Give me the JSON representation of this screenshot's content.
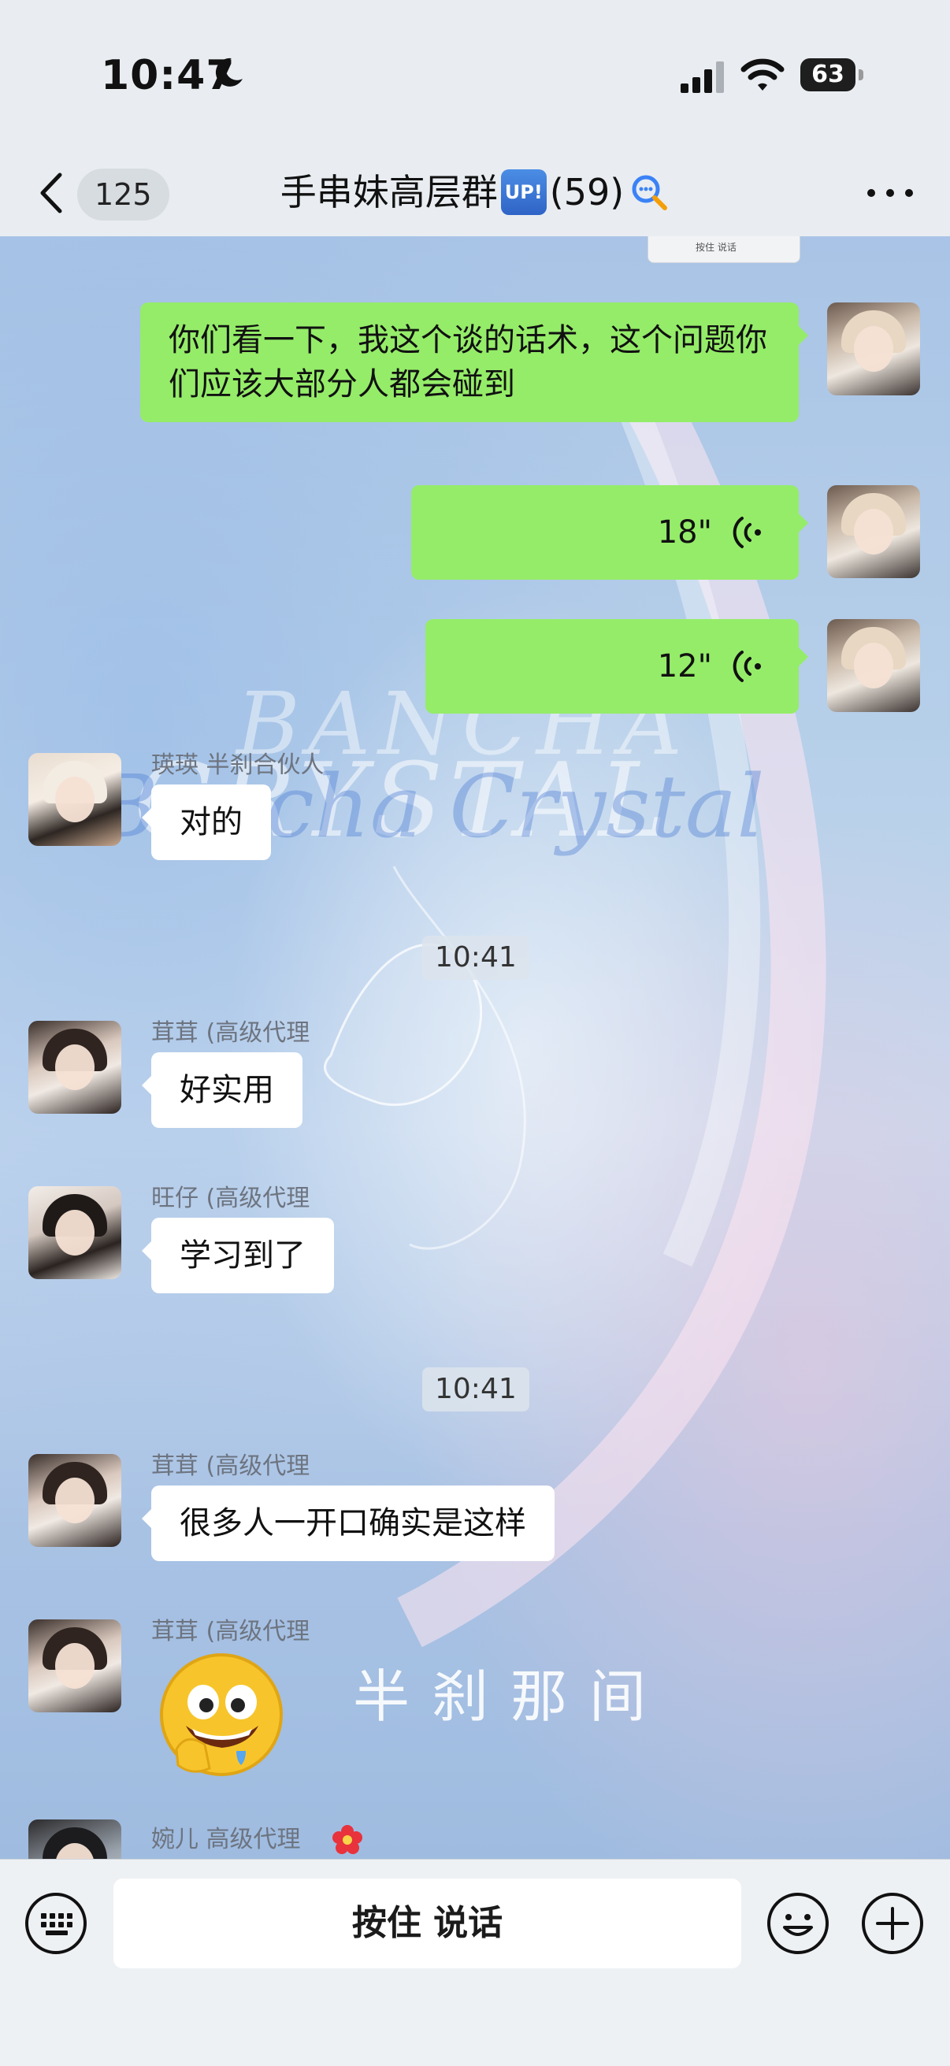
{
  "status_bar": {
    "time": "10:47",
    "battery": "63",
    "battery_level": 0.63
  },
  "nav": {
    "unread_count": "125",
    "title": "手串妹高层群",
    "title_badge": "UP!",
    "member_count": "(59)"
  },
  "shared_image_caption": "按住 说话",
  "watermark": {
    "script_top": "BANCHA",
    "script_bottom": "CRYSTAL",
    "script_blue": "Bancha Crystal",
    "chinese": "半刹那间"
  },
  "messages": {
    "m1": {
      "text": "你们看一下，我这个谈的话术，这个问题你们应该大部分人都会碰到"
    },
    "v1": {
      "duration": "18\""
    },
    "v2": {
      "duration": "12\""
    },
    "m2": {
      "sender": "瑛瑛 半刹合伙人",
      "text": "对的"
    },
    "t1": "10:41",
    "m3": {
      "sender": "茸茸 (高级代理",
      "text": "好实用"
    },
    "m4": {
      "sender": "旺仔 (高级代理",
      "text": "学习到了"
    },
    "t2": "10:41",
    "m5": {
      "sender": "茸茸 (高级代理",
      "text": "很多人一开口确实是这样"
    },
    "m6": {
      "sender": "茸茸 (高级代理"
    },
    "m7": {
      "sender": "婉儿 高级代理"
    }
  },
  "input_bar": {
    "hold_to_talk": "按住 说话"
  },
  "colors": {
    "outgoing_bubble": "#95ec69",
    "incoming_bubble": "#ffffff",
    "bar_bg": "#e9edf1"
  },
  "icons": [
    "moon-icon",
    "signal-icon",
    "wifi-icon",
    "battery-icon",
    "back-chevron-icon",
    "ai-search-icon",
    "more-icon",
    "voice-wave-icon",
    "keyboard-icon",
    "emoji-icon",
    "plus-icon",
    "flower-icon"
  ]
}
